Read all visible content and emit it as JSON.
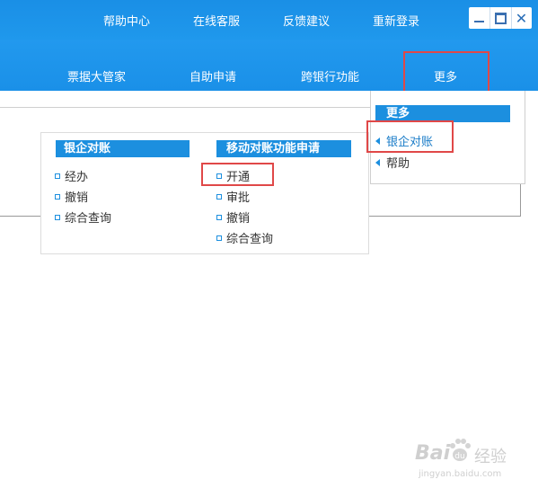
{
  "header": {
    "links": [
      "帮助中心",
      "在线客服",
      "反馈建议",
      "重新登录"
    ]
  },
  "window_controls": {
    "close_glyph": "✕"
  },
  "nav": {
    "items": [
      "票据大管家",
      "自助申请",
      "跨银行功能",
      "更多"
    ]
  },
  "mega_menu": {
    "sections": [
      {
        "title": "银企对账",
        "items": [
          "经办",
          "撤销",
          "综合查询"
        ]
      },
      {
        "title": "移动对账功能申请",
        "items": [
          "开通",
          "审批",
          "撤销",
          "综合查询"
        ]
      }
    ]
  },
  "more_panel": {
    "title": "更多",
    "items": [
      "银企对账",
      "帮助"
    ]
  },
  "watermark": {
    "brand": "Bai",
    "paw": "du",
    "cn": "经验",
    "url": "jingyan.baidu.com"
  },
  "colors": {
    "header_blue": "#1a8fe6",
    "section_blue": "#1c8fdf",
    "highlight_red": "#e04848"
  }
}
